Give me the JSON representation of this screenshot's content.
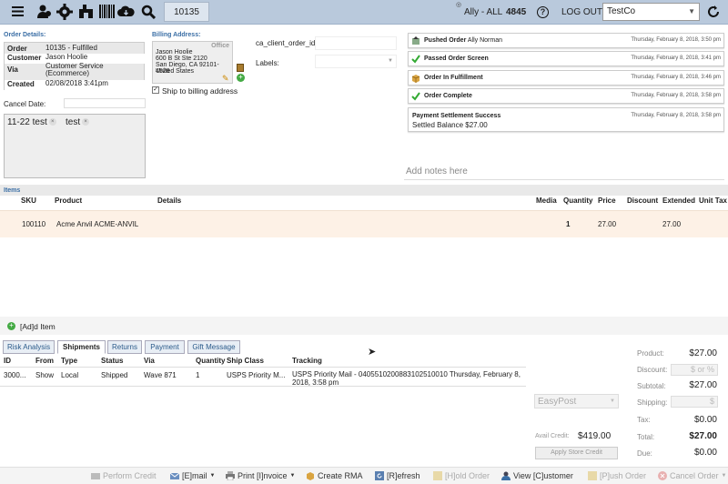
{
  "topbar": {
    "order_search": "10135",
    "user": "Ally - ALL",
    "user_count": "4845",
    "logout": "LOG OUT",
    "store": "TestCo"
  },
  "order_details": {
    "heading": "Order Details:",
    "rows": [
      {
        "key": "Order",
        "value": "10135 - Fulfilled"
      },
      {
        "key": "Customer",
        "value": "Jason Hoolie"
      },
      {
        "key": "Via",
        "value": "Customer Service (Ecommerce)"
      },
      {
        "key": "Created",
        "value": "02/08/2018 3:41pm"
      }
    ],
    "cancel_date_label": "Cancel Date:",
    "tags": [
      "11-22 test",
      "test"
    ]
  },
  "billing": {
    "heading": "Billing Address:",
    "office": "Office",
    "lines": [
      "Jason Hoolie",
      "600 B St Ste 2120",
      "San Diego, CA 92101-4526",
      "United States"
    ],
    "ship_to_billing": "Ship to billing address"
  },
  "custom_fields": {
    "client_order_id_label": "ca_client_order_id:",
    "labels_label": "Labels:"
  },
  "timeline": [
    {
      "title": "Pushed Order",
      "detail": " Ally Norman",
      "time": "Thursday, February 8, 2018, 3:50 pm",
      "icon": "push-icon"
    },
    {
      "title": "Passed Order Screen",
      "detail": "",
      "time": "Thursday, February 8, 2018, 3:41 pm",
      "icon": "check-icon"
    },
    {
      "title": "Order In Fulfillment",
      "detail": "",
      "time": "Thursday, February 8, 2018, 3:46 pm",
      "icon": "box-icon"
    },
    {
      "title": "Order Complete",
      "detail": "",
      "time": "Thursday, February 8, 2018, 3:58 pm",
      "icon": "check-icon"
    }
  ],
  "payment_event": {
    "title": "Payment Settlement Success",
    "time": "Thursday, February 8, 2018, 3:58 pm",
    "detail": "Settled Balance $27.00"
  },
  "notes_placeholder": "Add notes here",
  "items": {
    "heading": "Items",
    "columns": [
      "SKU",
      "Product",
      "Details",
      "Media",
      "Quantity",
      "Price",
      "Discount",
      "Extended",
      "Unit Tax"
    ],
    "rows": [
      {
        "sku": "100110",
        "product": "Acme Anvil ACME-ANVIL",
        "quantity": "1",
        "price": "27.00",
        "extended": "27.00"
      }
    ],
    "add_item": "[Ad]d Item"
  },
  "tabs": [
    "Risk Analysis",
    "Shipments",
    "Returns",
    "Payment",
    "Gift Message"
  ],
  "shipments": {
    "columns": [
      "ID",
      "From",
      "Type",
      "Status",
      "Via",
      "Quantity",
      "Ship Class",
      "Tracking"
    ],
    "rows": [
      {
        "id": "3000...",
        "from": "Show",
        "type": "Local",
        "status": "Shipped",
        "via": "Wave 871",
        "quantity": "1",
        "ship_class": "USPS Priority M...",
        "tracking": "USPS Priority Mail - 04055102008831025100​10 Thursday, February 8, 2018, 3:58 pm"
      }
    ]
  },
  "totals": {
    "product_label": "Product:",
    "product": "$27.00",
    "discount_label": "Discount:",
    "discount_placeholder": "$ or %",
    "subtotal_label": "Subtotal:",
    "subtotal": "$27.00",
    "shipping_label": "Shipping:",
    "shipping_placeholder": "$",
    "tax_label": "Tax:",
    "tax": "$0.00",
    "total_label": "Total:",
    "total": "$27.00",
    "due_label": "Due:",
    "due": "$0.00",
    "easypost": "EasyPost",
    "avail_credit_label": "Avail Credit:",
    "avail_credit": "$419.00",
    "apply_store_credit": "Apply Store Credit"
  },
  "bottom_actions": [
    {
      "label": "Perform Credit",
      "enabled": false
    },
    {
      "label": "[E]mail",
      "enabled": true
    },
    {
      "label": "Print [I]nvoice",
      "enabled": true
    },
    {
      "label": "Create RMA",
      "enabled": true
    },
    {
      "label": "[R]efresh",
      "enabled": true
    },
    {
      "label": "[H]old Order",
      "enabled": false
    },
    {
      "label": "View [C]ustomer",
      "enabled": true
    },
    {
      "label": "[P]ush Order",
      "enabled": false
    },
    {
      "label": "Cancel Order",
      "enabled": false
    }
  ]
}
